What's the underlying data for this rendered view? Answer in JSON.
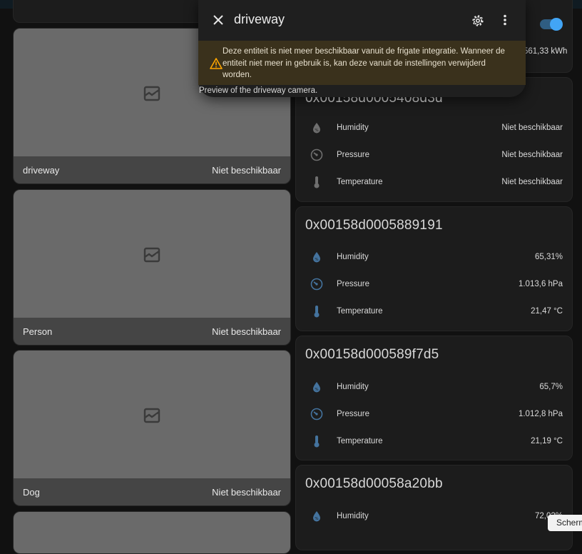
{
  "dialog": {
    "title": "driveway",
    "warning": "Deze entiteit is niet meer beschikbaar vanuit de frigate integratie. Wanneer de entiteit niet meer in gebruik is, kan deze vanuit de instellingen verwijderd worden.",
    "preview_caption": "Preview of the driveway camera."
  },
  "top_right": {
    "energy_value": "561,33 kWh",
    "toggle_on": true
  },
  "cameras": [
    {
      "name": "driveway",
      "status": "Niet beschikbaar"
    },
    {
      "name": "Person",
      "status": "Niet beschikbaar"
    },
    {
      "name": "Dog",
      "status": "Niet beschikbaar"
    }
  ],
  "sensors": [
    {
      "title": "0x00158d0005408d3d",
      "rows": [
        {
          "name": "Humidity",
          "value": "Niet beschikbaar",
          "icon": "water-percent-icon"
        },
        {
          "name": "Pressure",
          "value": "Niet beschikbaar",
          "icon": "gauge-icon"
        },
        {
          "name": "Temperature",
          "value": "Niet beschikbaar",
          "icon": "thermometer-icon"
        }
      ]
    },
    {
      "title": "0x00158d0005889191",
      "rows": [
        {
          "name": "Humidity",
          "value": "65,31%",
          "icon": "water-percent-icon"
        },
        {
          "name": "Pressure",
          "value": "1.013,6 hPa",
          "icon": "gauge-icon"
        },
        {
          "name": "Temperature",
          "value": "21,47 °C",
          "icon": "thermometer-icon"
        }
      ]
    },
    {
      "title": "0x00158d000589f7d5",
      "rows": [
        {
          "name": "Humidity",
          "value": "65,7%",
          "icon": "water-percent-icon"
        },
        {
          "name": "Pressure",
          "value": "1.012,8 hPa",
          "icon": "gauge-icon"
        },
        {
          "name": "Temperature",
          "value": "21,19 °C",
          "icon": "thermometer-icon"
        }
      ]
    },
    {
      "title": "0x00158d00058a20bb",
      "rows": [
        {
          "name": "Humidity",
          "value": "72,02%",
          "icon": "water-percent-icon"
        }
      ]
    }
  ],
  "tooltip": "Scherm",
  "colors": {
    "active_icon": "#44739e",
    "inactive_icon": "#6f6f6f",
    "warning": "#ffa600",
    "toggle": "#42a5f5"
  }
}
